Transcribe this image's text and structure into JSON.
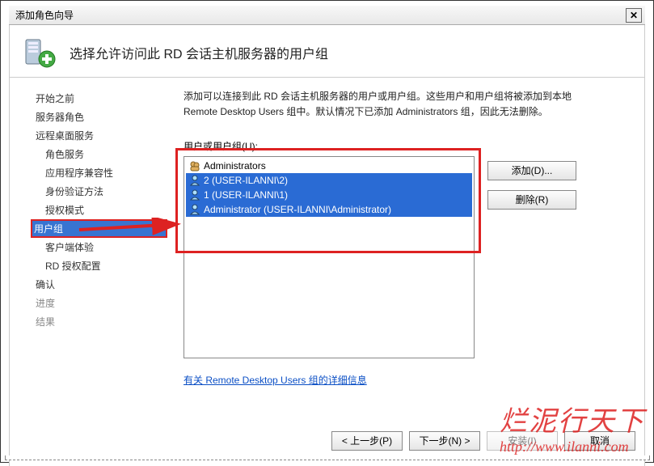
{
  "window": {
    "title": "添加角色向导",
    "close": "✕"
  },
  "header": {
    "title": "选择允许访问此 RD 会话主机服务器的用户组"
  },
  "sidebar": {
    "items": [
      {
        "label": "开始之前",
        "sub": false
      },
      {
        "label": "服务器角色",
        "sub": false
      },
      {
        "label": "远程桌面服务",
        "sub": false
      },
      {
        "label": "角色服务",
        "sub": true
      },
      {
        "label": "应用程序兼容性",
        "sub": true
      },
      {
        "label": "身份验证方法",
        "sub": true
      },
      {
        "label": "授权模式",
        "sub": true
      },
      {
        "label": "用户组",
        "sub": true,
        "selected": true
      },
      {
        "label": "客户端体验",
        "sub": true
      },
      {
        "label": "RD 授权配置",
        "sub": true
      },
      {
        "label": "确认",
        "sub": false
      },
      {
        "label": "进度",
        "sub": false,
        "dim": true
      },
      {
        "label": "结果",
        "sub": false,
        "dim": true
      }
    ]
  },
  "main": {
    "description": "添加可以连接到此 RD 会话主机服务器的用户或用户组。这些用户和用户组将被添加到本地 Remote Desktop Users 组中。默认情况下已添加 Administrators 组，因此无法删除。",
    "list_label": "用户或用户组(U):",
    "list": [
      {
        "label": "Administrators",
        "type": "group",
        "selected": false
      },
      {
        "label": "2 (USER-ILANNI\\2)",
        "type": "user",
        "selected": true
      },
      {
        "label": "1 (USER-ILANNI\\1)",
        "type": "user",
        "selected": true
      },
      {
        "label": "Administrator (USER-ILANNI\\Administrator)",
        "type": "user",
        "selected": true
      }
    ],
    "add_btn": "添加(D)...",
    "remove_btn": "删除(R)",
    "link": "有关 Remote Desktop Users 组的详细信息"
  },
  "footer": {
    "back": "< 上一步(P)",
    "next": "下一步(N) >",
    "install": "安装(I)",
    "cancel": "取消"
  },
  "watermark": {
    "cn": "烂泥行天下",
    "url": "http://www.ilanni.com"
  }
}
